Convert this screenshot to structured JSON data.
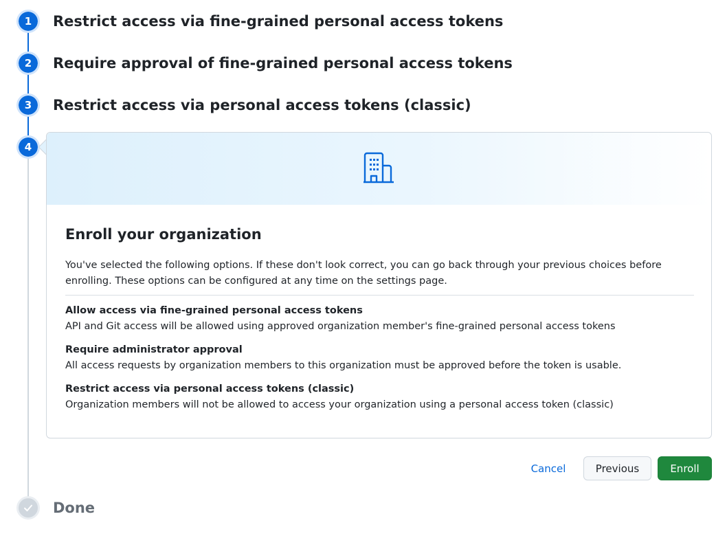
{
  "steps": [
    {
      "number": "1",
      "title": "Restrict access via fine-grained personal access tokens"
    },
    {
      "number": "2",
      "title": "Require approval of fine-grained personal access tokens"
    },
    {
      "number": "3",
      "title": "Restrict access via personal access tokens (classic)"
    },
    {
      "number": "4",
      "title": ""
    }
  ],
  "done_step": {
    "icon": "check-icon",
    "title": "Done"
  },
  "card": {
    "icon": "organization-icon",
    "heading": "Enroll your organization",
    "description": "You've selected the following options. If these don't look correct, you can go back through your previous choices before enrolling. These options can be configured at any time on the settings page.",
    "options": [
      {
        "title": "Allow access via fine-grained personal access tokens",
        "description": "API and Git access will be allowed using approved organization member's fine-grained personal access tokens"
      },
      {
        "title": "Require administrator approval",
        "description": "All access requests by organization members to this organization must be approved before the token is usable."
      },
      {
        "title": "Restrict access via personal access tokens (classic)",
        "description": "Organization members will not be allowed to access your organization using a personal access token (classic)"
      }
    ]
  },
  "actions": {
    "cancel": "Cancel",
    "previous": "Previous",
    "enroll": "Enroll"
  },
  "colors": {
    "accent": "#0969da",
    "success": "#1f883d",
    "muted": "#656d76"
  }
}
